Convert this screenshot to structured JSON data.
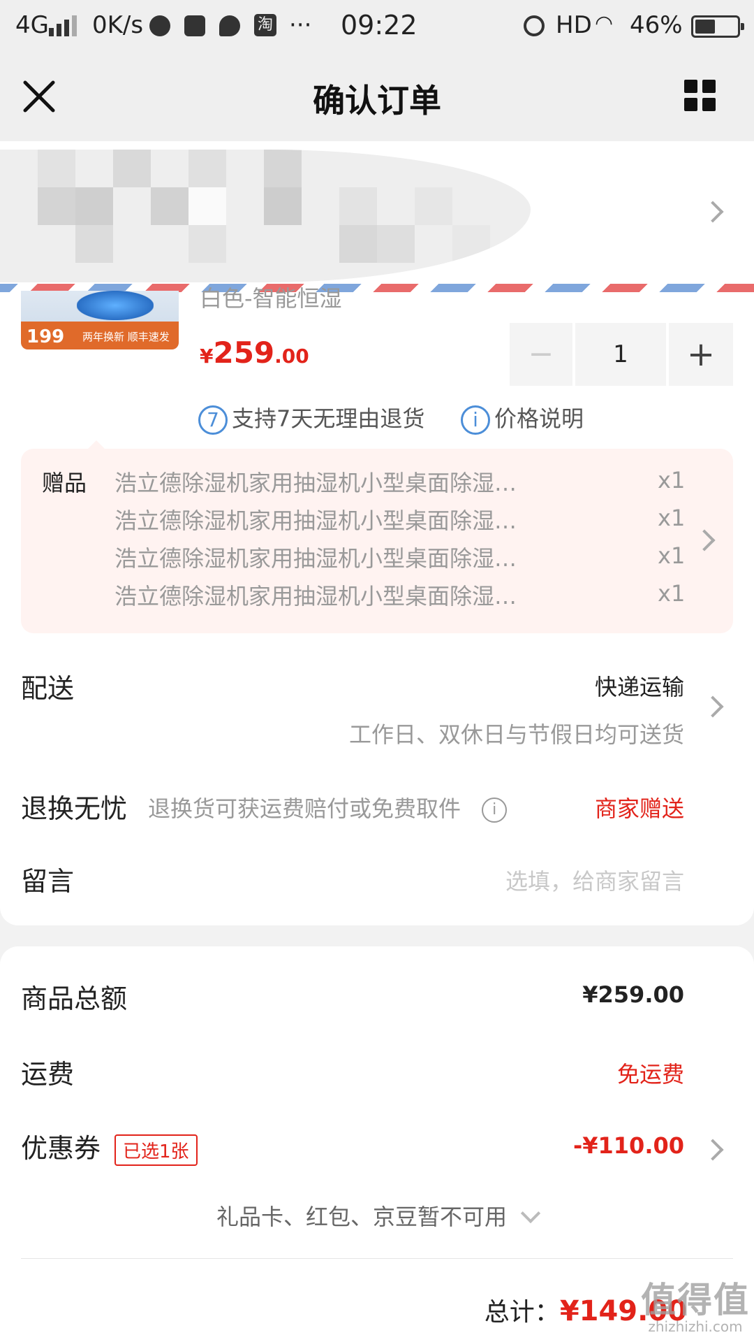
{
  "status_bar": {
    "network": "4G",
    "speed": "0K/s",
    "taobao": "淘",
    "more": "···",
    "time": "09:22",
    "hd": "HD",
    "battery": "46%",
    "battery_level": 0.46
  },
  "header": {
    "title": "确认订单"
  },
  "product": {
    "variant": "白色-智能恒湿",
    "image_price": "199",
    "image_slogan": "两年换新 顺丰速发",
    "price_currency": "¥",
    "price_int": "259",
    "price_dec": ".00",
    "quantity": "1",
    "minus": "−",
    "plus": "+"
  },
  "policies": [
    {
      "icon": "7",
      "text": "支持7天无理由退货"
    },
    {
      "icon": "i",
      "text": "价格说明"
    }
  ],
  "gifts": {
    "label": "赠品",
    "items": [
      {
        "name": "浩立德除湿机家用抽湿机小型桌面除湿器干…",
        "qty": "x1"
      },
      {
        "name": "浩立德除湿机家用抽湿机小型桌面除湿器干…",
        "qty": "x1"
      },
      {
        "name": "浩立德除湿机家用抽湿机小型桌面除湿器干…",
        "qty": "x1"
      },
      {
        "name": "浩立德除湿机家用抽湿机小型桌面除湿器干…",
        "qty": "x1"
      }
    ]
  },
  "delivery": {
    "label": "配送",
    "value": "快递运输",
    "sub": "工作日、双休日与节假日均可送货"
  },
  "returns": {
    "label": "退换无忧",
    "desc": "退换货可获运费赔付或免费取件",
    "info": "i",
    "value": "商家赠送"
  },
  "message": {
    "label": "留言",
    "placeholder": "选填，给商家留言"
  },
  "summary": {
    "subtotal_label": "商品总额",
    "subtotal_value": "¥259.00",
    "shipping_label": "运费",
    "shipping_value": "免运费",
    "coupon_label": "优惠券",
    "coupon_badge": "已选1张",
    "coupon_value": "-¥110.00",
    "gift_card_text": "礼品卡、红包、京豆暂不可用",
    "total_label": "总计：",
    "total_value": "¥149.00"
  },
  "watermark": {
    "big": "值得值",
    "small": "zhizhizhi.com"
  },
  "colors": {
    "accent": "#e2231a",
    "link_blue": "#4c8ed8",
    "gift_bg": "#fff3f1"
  }
}
